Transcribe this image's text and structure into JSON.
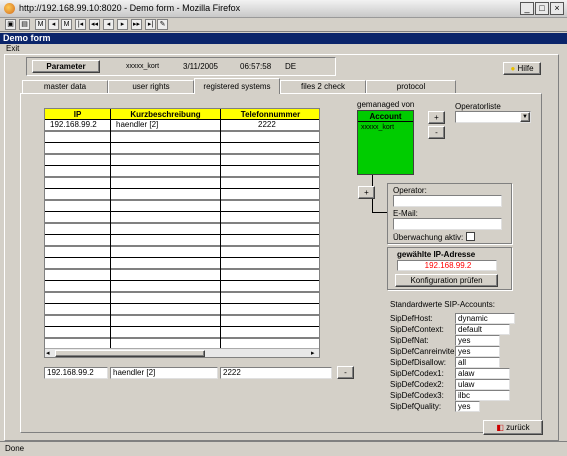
{
  "window": {
    "title": "http://192.168.99.10:8020 - Demo form - Mozilla Firefox",
    "min": "_",
    "max": "□",
    "close": "×"
  },
  "toolbar_icons": [
    "save-icon",
    "print-icon",
    "first-record-icon",
    "prev-page-icon",
    "first-icon",
    "rewind-icon",
    "prev-icon",
    "next-icon",
    "forward-icon",
    "last-icon",
    "edit-icon"
  ],
  "app": {
    "header": "Demo form",
    "menu_exit": "Exit"
  },
  "param_bar": {
    "button_label": "Parameter",
    "user": "xxxxx_kort",
    "date": "3/11/2005",
    "time": "06:57:58",
    "lang": "DE",
    "help_label": "Hilfe"
  },
  "tabs": [
    {
      "label": "master data"
    },
    {
      "label": "user rights"
    },
    {
      "label": "registered systems"
    },
    {
      "label": "files 2 check"
    },
    {
      "label": "protocol"
    }
  ],
  "grid": {
    "columns": [
      "IP",
      "Kurzbeschreibung",
      "Telefonnummer"
    ],
    "rows": [
      [
        "192.168.99.2",
        "haendler [2]",
        "2222"
      ]
    ]
  },
  "edit_row": {
    "ip": "192.168.99.2",
    "desc": "haendler [2]",
    "phone": "2222",
    "minus": "-"
  },
  "managed": {
    "label": "gemanaged von",
    "header": "Account",
    "rows": [
      "xxxxx_kort"
    ],
    "plus": "+",
    "minus": "-"
  },
  "operator_list": {
    "label": "Operatorliste",
    "value": ""
  },
  "operator_box": {
    "plus": "+",
    "operator_label": "Operator:",
    "operator_value": "",
    "email_label": "E-Mail:",
    "email_value": "",
    "monitor_label": "Überwachung aktiv:"
  },
  "ip_box": {
    "title": "gewählte IP-Adresse",
    "value": "192.168.99.2",
    "button": "Konfiguration prüfen"
  },
  "sip": {
    "title": "Standardwerte SIP-Accounts:",
    "fields": [
      {
        "label": "SipDefHost:",
        "value": "dynamic"
      },
      {
        "label": "SipDefContext:",
        "value": "default"
      },
      {
        "label": "SipDefNat:",
        "value": "yes"
      },
      {
        "label": "SipDefCanreinvite:",
        "value": "yes"
      },
      {
        "label": "SipDefDisallow:",
        "value": "all"
      },
      {
        "label": "SipDefCodex1:",
        "value": "alaw"
      },
      {
        "label": "SipDefCodex2:",
        "value": "ulaw"
      },
      {
        "label": "SipDefCodex3:",
        "value": "ilbc"
      },
      {
        "label": "SipDefQuality:",
        "value": "yes"
      }
    ]
  },
  "back_button": "zurück",
  "status": "Done",
  "colors": {
    "header_bg": "#0a246a",
    "grid_header": "#ffff00",
    "account_header": "#00cc00",
    "ip_red": "#ff0000"
  }
}
